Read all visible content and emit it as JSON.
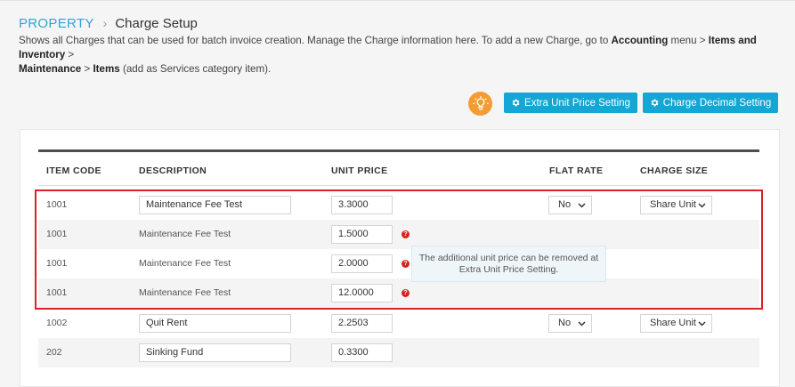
{
  "breadcrumb": {
    "root": "PROPERTY",
    "separator": "›",
    "current": "Charge Setup"
  },
  "description": {
    "part1": "Shows all Charges that can be used for batch invoice creation. Manage the Charge information here. To add a new Charge, go to ",
    "accounting": "Accounting",
    "part2": " menu > ",
    "items_inventory": "Items and Inventory",
    "part3": " > ",
    "maintenance": "Maintenance",
    "part4": " > ",
    "items": "Items",
    "part5": " (add as Services category item)."
  },
  "toolbar": {
    "extra_unit_price_label": "Extra Unit Price Setting",
    "charge_decimal_label": "Charge Decimal Setting"
  },
  "table": {
    "headers": {
      "item_code": "ITEM CODE",
      "description": "DESCRIPTION",
      "unit_price": "UNIT PRICE",
      "flat_rate": "FLAT RATE",
      "charge_size": "CHARGE SIZE"
    },
    "rows": [
      {
        "code": "1001",
        "description": "Maintenance Fee Test",
        "unit_price": "3.3000",
        "flat_rate": "No",
        "charge_size": "Share Unit"
      },
      {
        "code": "1001",
        "description": "Maintenance Fee Test",
        "unit_price": "1.5000"
      },
      {
        "code": "1001",
        "description": "Maintenance Fee Test",
        "unit_price": "2.0000"
      },
      {
        "code": "1001",
        "description": "Maintenance Fee Test",
        "unit_price": "12.0000"
      },
      {
        "code": "1002",
        "description": "Quit Rent",
        "unit_price": "2.2503",
        "flat_rate": "No",
        "charge_size": "Share Unit"
      },
      {
        "code": "202",
        "description": "Sinking Fund",
        "unit_price": "0.3300"
      }
    ]
  },
  "tooltip": {
    "line1": "The additional unit price can be removed at",
    "line2": "Extra Unit Price Setting."
  },
  "help_icon_glyph": "?",
  "colors": {
    "accent": "#2aa6d8",
    "button": "#14a6d4",
    "bulb": "#f39c33",
    "highlight_border": "#e01e24",
    "help_icon": "#d9221c"
  }
}
